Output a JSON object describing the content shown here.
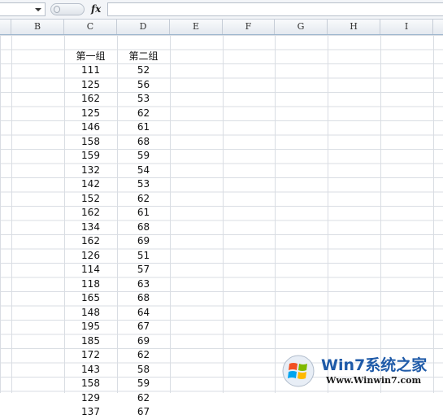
{
  "columns": [
    "B",
    "C",
    "D",
    "E",
    "F",
    "G",
    "H",
    "I"
  ],
  "formula_bar": {
    "fx_label": "fx",
    "formula_value": ""
  },
  "table": {
    "headers": [
      "第一组",
      "第二组"
    ],
    "rows": [
      [
        "111",
        "52"
      ],
      [
        "125",
        "56"
      ],
      [
        "162",
        "53"
      ],
      [
        "125",
        "62"
      ],
      [
        "146",
        "61"
      ],
      [
        "158",
        "68"
      ],
      [
        "159",
        "59"
      ],
      [
        "132",
        "54"
      ],
      [
        "142",
        "53"
      ],
      [
        "152",
        "62"
      ],
      [
        "162",
        "61"
      ],
      [
        "134",
        "68"
      ],
      [
        "162",
        "69"
      ],
      [
        "126",
        "51"
      ],
      [
        "114",
        "57"
      ],
      [
        "118",
        "63"
      ],
      [
        "165",
        "68"
      ],
      [
        "148",
        "64"
      ],
      [
        "195",
        "67"
      ],
      [
        "185",
        "69"
      ],
      [
        "172",
        "62"
      ],
      [
        "143",
        "58"
      ],
      [
        "158",
        "59"
      ],
      [
        "129",
        "62"
      ],
      [
        "137",
        "67"
      ]
    ]
  },
  "watermark": {
    "title": "Win7系统之家",
    "url": "Www.Winwin7.com"
  }
}
